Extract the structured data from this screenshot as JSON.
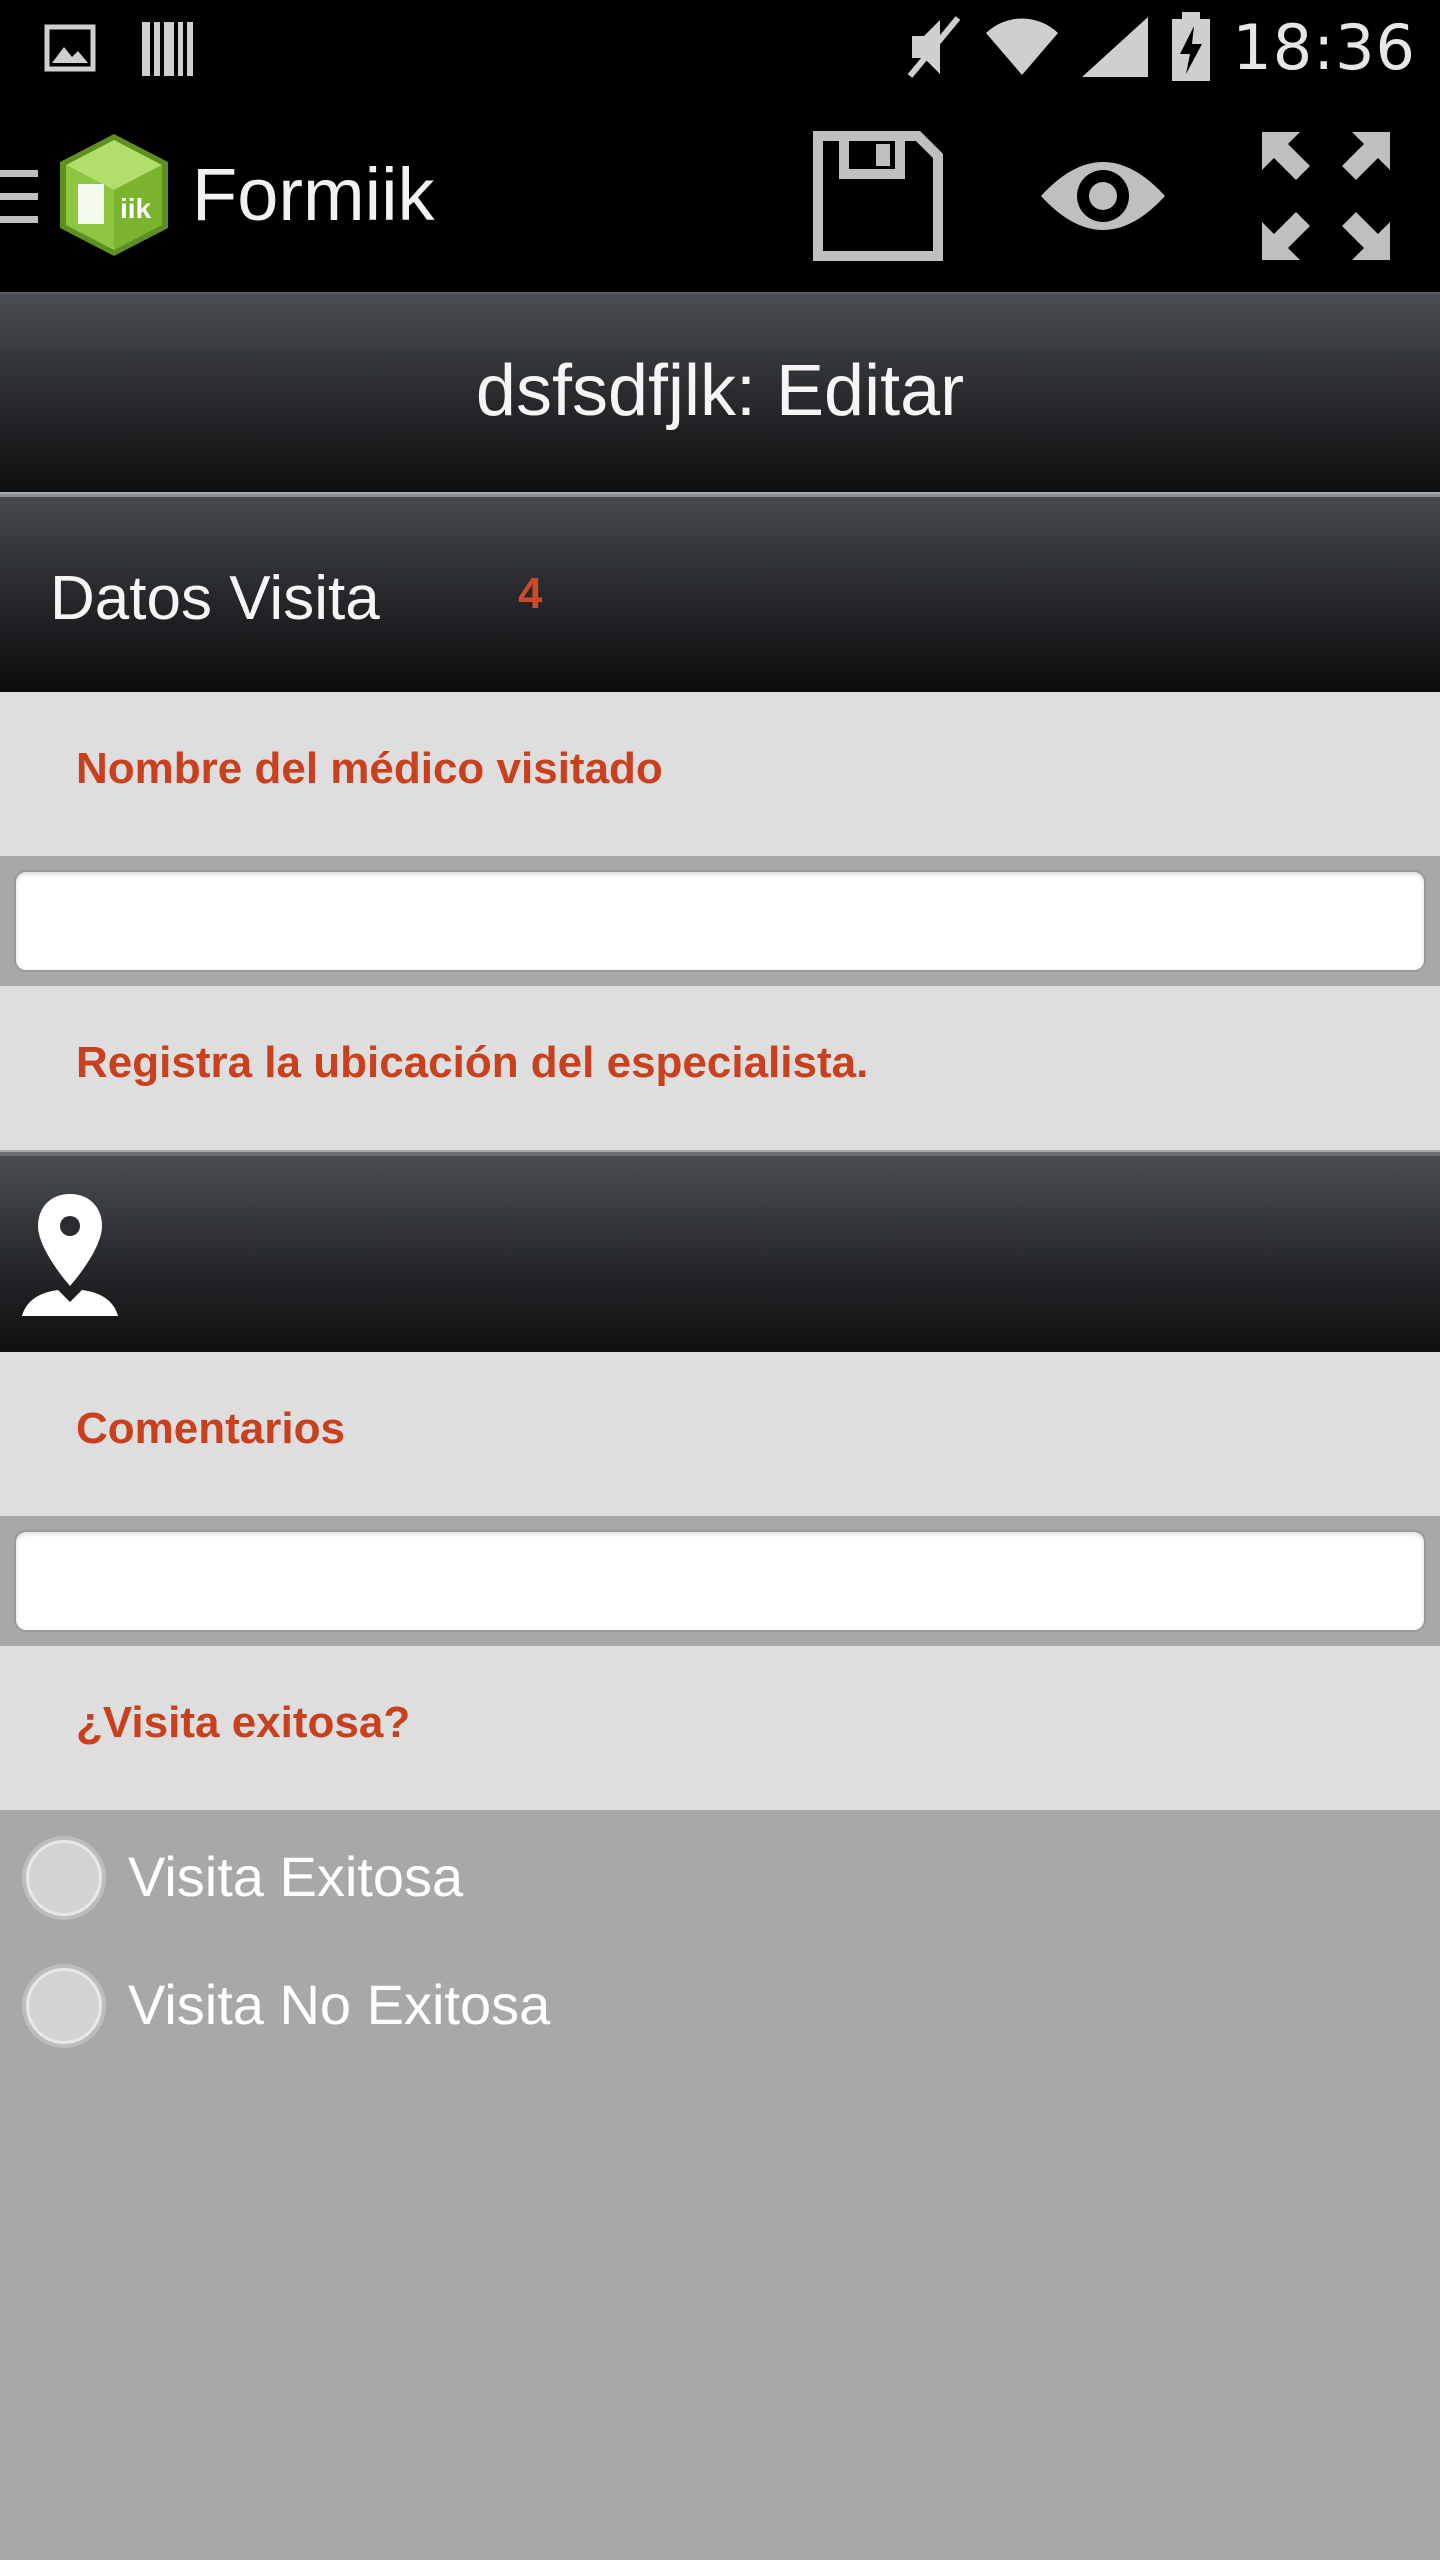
{
  "status_bar": {
    "time": "18:36",
    "icons": [
      "image-notification-icon",
      "barcode-icon",
      "mute-icon",
      "wifi-icon",
      "signal-icon",
      "battery-charging-icon"
    ]
  },
  "action_bar": {
    "app_name": "Formiik",
    "actions": [
      "save-icon",
      "eye-icon",
      "fullscreen-icon"
    ]
  },
  "header": {
    "title": "dsfsdfjlk: Editar"
  },
  "section": {
    "title": "Datos Visita",
    "count": "4"
  },
  "questions": {
    "q1_label": "Nombre del médico visitado",
    "q1_value": "",
    "q2_label": "Registra la ubicación del especialista.",
    "q3_label": "Comentarios",
    "q3_value": "",
    "q4_label": "¿Visita exitosa?",
    "q4_options": [
      "Visita Exitosa",
      "Visita No Exitosa"
    ]
  },
  "colors": {
    "accent_label": "#c8401e",
    "count": "#cc4a2a",
    "panel_light": "#dedede",
    "background": "#a7a8aa",
    "logo_green": "#8dc63f"
  }
}
